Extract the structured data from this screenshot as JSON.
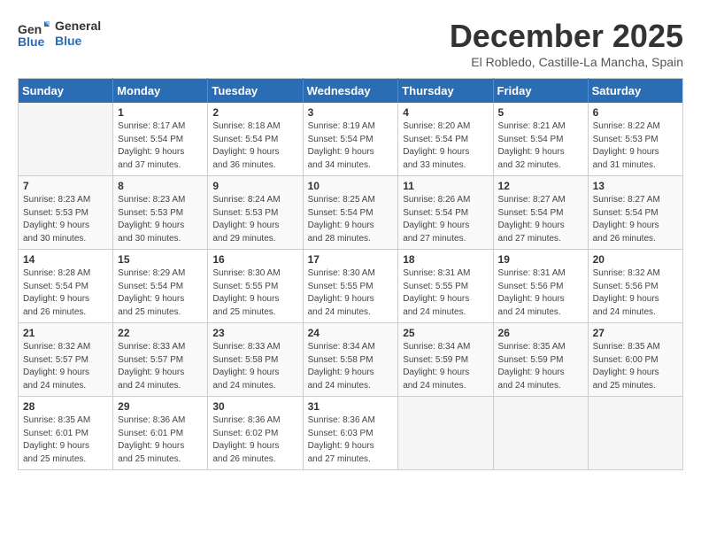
{
  "header": {
    "logo_line1": "General",
    "logo_line2": "Blue",
    "month": "December 2025",
    "location": "El Robledo, Castille-La Mancha, Spain"
  },
  "weekdays": [
    "Sunday",
    "Monday",
    "Tuesday",
    "Wednesday",
    "Thursday",
    "Friday",
    "Saturday"
  ],
  "weeks": [
    [
      {
        "day": "",
        "info": ""
      },
      {
        "day": "1",
        "info": "Sunrise: 8:17 AM\nSunset: 5:54 PM\nDaylight: 9 hours\nand 37 minutes."
      },
      {
        "day": "2",
        "info": "Sunrise: 8:18 AM\nSunset: 5:54 PM\nDaylight: 9 hours\nand 36 minutes."
      },
      {
        "day": "3",
        "info": "Sunrise: 8:19 AM\nSunset: 5:54 PM\nDaylight: 9 hours\nand 34 minutes."
      },
      {
        "day": "4",
        "info": "Sunrise: 8:20 AM\nSunset: 5:54 PM\nDaylight: 9 hours\nand 33 minutes."
      },
      {
        "day": "5",
        "info": "Sunrise: 8:21 AM\nSunset: 5:54 PM\nDaylight: 9 hours\nand 32 minutes."
      },
      {
        "day": "6",
        "info": "Sunrise: 8:22 AM\nSunset: 5:53 PM\nDaylight: 9 hours\nand 31 minutes."
      }
    ],
    [
      {
        "day": "7",
        "info": "Sunrise: 8:23 AM\nSunset: 5:53 PM\nDaylight: 9 hours\nand 30 minutes."
      },
      {
        "day": "8",
        "info": "Sunrise: 8:23 AM\nSunset: 5:53 PM\nDaylight: 9 hours\nand 30 minutes."
      },
      {
        "day": "9",
        "info": "Sunrise: 8:24 AM\nSunset: 5:53 PM\nDaylight: 9 hours\nand 29 minutes."
      },
      {
        "day": "10",
        "info": "Sunrise: 8:25 AM\nSunset: 5:54 PM\nDaylight: 9 hours\nand 28 minutes."
      },
      {
        "day": "11",
        "info": "Sunrise: 8:26 AM\nSunset: 5:54 PM\nDaylight: 9 hours\nand 27 minutes."
      },
      {
        "day": "12",
        "info": "Sunrise: 8:27 AM\nSunset: 5:54 PM\nDaylight: 9 hours\nand 27 minutes."
      },
      {
        "day": "13",
        "info": "Sunrise: 8:27 AM\nSunset: 5:54 PM\nDaylight: 9 hours\nand 26 minutes."
      }
    ],
    [
      {
        "day": "14",
        "info": "Sunrise: 8:28 AM\nSunset: 5:54 PM\nDaylight: 9 hours\nand 26 minutes."
      },
      {
        "day": "15",
        "info": "Sunrise: 8:29 AM\nSunset: 5:54 PM\nDaylight: 9 hours\nand 25 minutes."
      },
      {
        "day": "16",
        "info": "Sunrise: 8:30 AM\nSunset: 5:55 PM\nDaylight: 9 hours\nand 25 minutes."
      },
      {
        "day": "17",
        "info": "Sunrise: 8:30 AM\nSunset: 5:55 PM\nDaylight: 9 hours\nand 24 minutes."
      },
      {
        "day": "18",
        "info": "Sunrise: 8:31 AM\nSunset: 5:55 PM\nDaylight: 9 hours\nand 24 minutes."
      },
      {
        "day": "19",
        "info": "Sunrise: 8:31 AM\nSunset: 5:56 PM\nDaylight: 9 hours\nand 24 minutes."
      },
      {
        "day": "20",
        "info": "Sunrise: 8:32 AM\nSunset: 5:56 PM\nDaylight: 9 hours\nand 24 minutes."
      }
    ],
    [
      {
        "day": "21",
        "info": "Sunrise: 8:32 AM\nSunset: 5:57 PM\nDaylight: 9 hours\nand 24 minutes."
      },
      {
        "day": "22",
        "info": "Sunrise: 8:33 AM\nSunset: 5:57 PM\nDaylight: 9 hours\nand 24 minutes."
      },
      {
        "day": "23",
        "info": "Sunrise: 8:33 AM\nSunset: 5:58 PM\nDaylight: 9 hours\nand 24 minutes."
      },
      {
        "day": "24",
        "info": "Sunrise: 8:34 AM\nSunset: 5:58 PM\nDaylight: 9 hours\nand 24 minutes."
      },
      {
        "day": "25",
        "info": "Sunrise: 8:34 AM\nSunset: 5:59 PM\nDaylight: 9 hours\nand 24 minutes."
      },
      {
        "day": "26",
        "info": "Sunrise: 8:35 AM\nSunset: 5:59 PM\nDaylight: 9 hours\nand 24 minutes."
      },
      {
        "day": "27",
        "info": "Sunrise: 8:35 AM\nSunset: 6:00 PM\nDaylight: 9 hours\nand 25 minutes."
      }
    ],
    [
      {
        "day": "28",
        "info": "Sunrise: 8:35 AM\nSunset: 6:01 PM\nDaylight: 9 hours\nand 25 minutes."
      },
      {
        "day": "29",
        "info": "Sunrise: 8:36 AM\nSunset: 6:01 PM\nDaylight: 9 hours\nand 25 minutes."
      },
      {
        "day": "30",
        "info": "Sunrise: 8:36 AM\nSunset: 6:02 PM\nDaylight: 9 hours\nand 26 minutes."
      },
      {
        "day": "31",
        "info": "Sunrise: 8:36 AM\nSunset: 6:03 PM\nDaylight: 9 hours\nand 27 minutes."
      },
      {
        "day": "",
        "info": ""
      },
      {
        "day": "",
        "info": ""
      },
      {
        "day": "",
        "info": ""
      }
    ]
  ]
}
